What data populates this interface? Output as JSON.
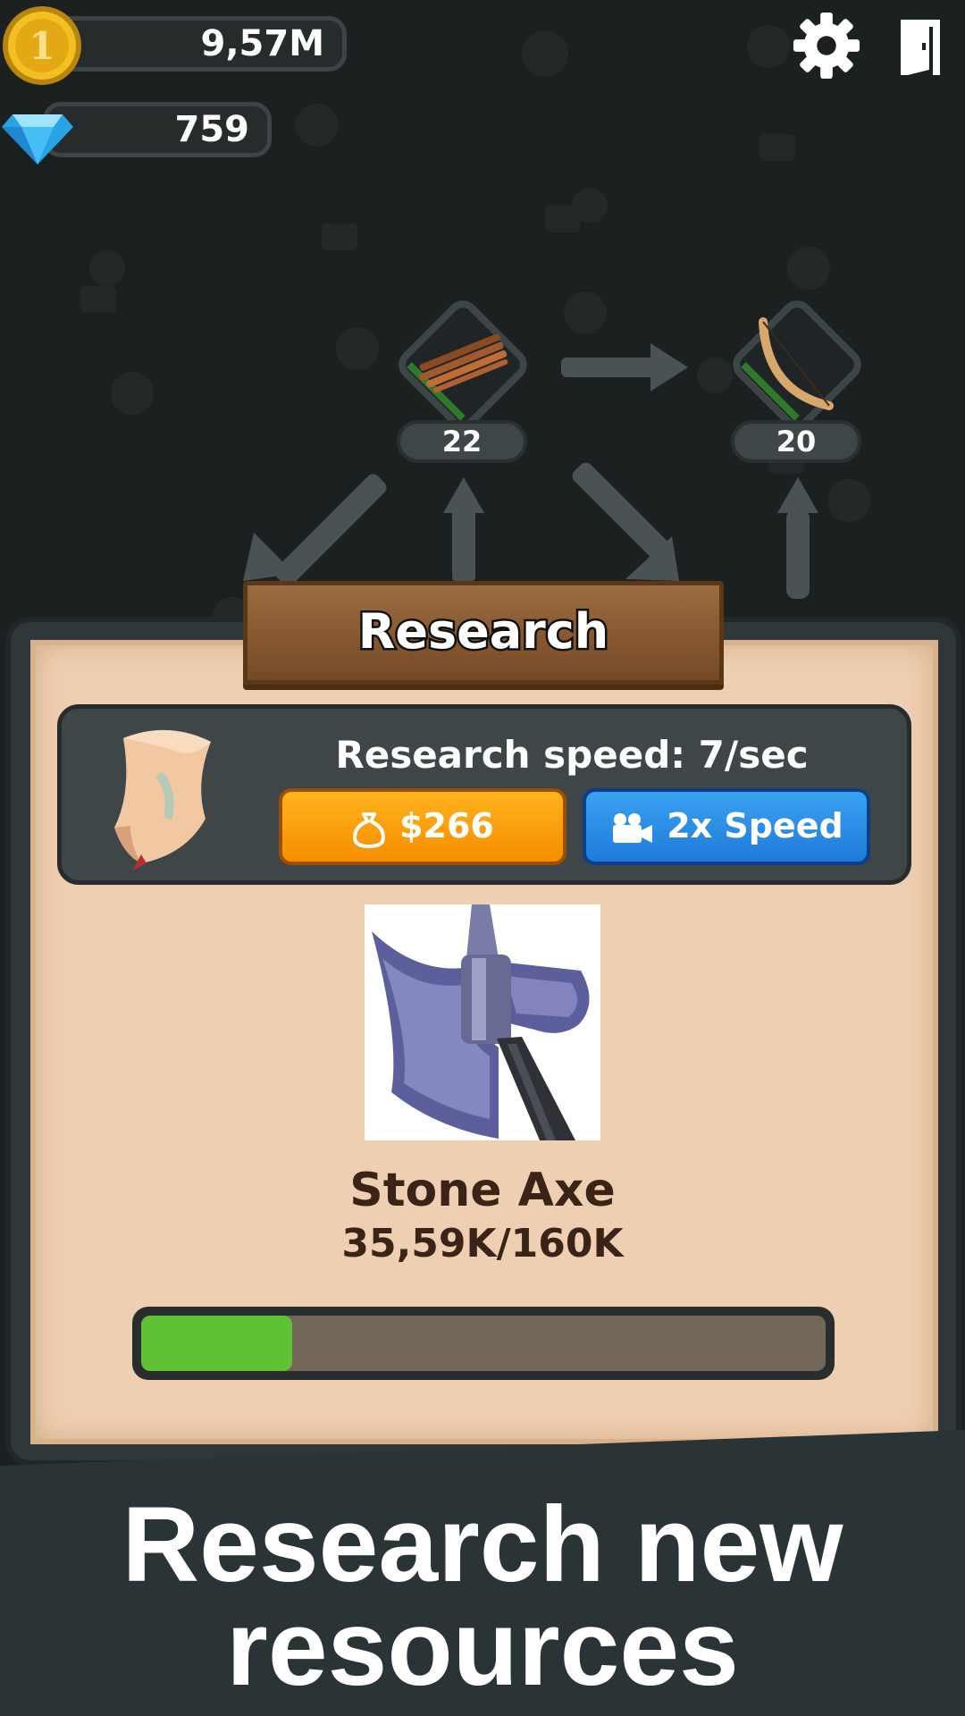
{
  "hud": {
    "coins": "9,57M",
    "gems": "759",
    "coin_icon": "gold-coin-icon",
    "gem_icon": "diamond-icon",
    "settings_icon": "gear-icon",
    "exit_icon": "door-icon"
  },
  "tech_tree": {
    "nodes": [
      {
        "item": "wood-sticks",
        "count": "22"
      },
      {
        "item": "bow",
        "count": "20"
      }
    ]
  },
  "panel": {
    "title": "Research",
    "speed_text": "Research speed: 7/sec",
    "buy_button": "$266",
    "speed_button": "2x Speed",
    "item_name": "Stone Axe",
    "item_progress": "35,59K/160K",
    "progress_fraction": 0.22
  },
  "slogan": {
    "line1": "Research new",
    "line2": "resources"
  },
  "colors": {
    "accent_orange": "#f7a10e",
    "accent_blue": "#2a8de6",
    "progress_green": "#5fc232",
    "panel_bg": "#efcfb1"
  }
}
